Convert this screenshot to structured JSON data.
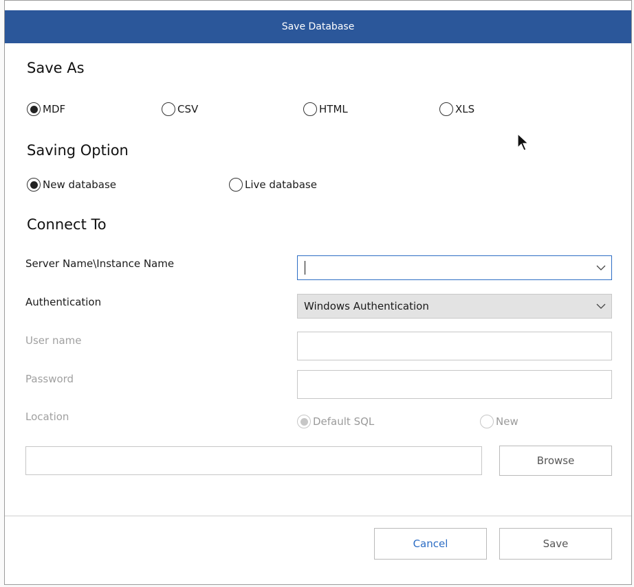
{
  "dialog": {
    "title": "Save Database"
  },
  "save_as": {
    "heading": "Save As",
    "options": [
      {
        "label": "MDF",
        "checked": true
      },
      {
        "label": "CSV",
        "checked": false
      },
      {
        "label": "HTML",
        "checked": false
      },
      {
        "label": "XLS",
        "checked": false
      }
    ]
  },
  "saving_option": {
    "heading": "Saving Option",
    "options": [
      {
        "label": "New database",
        "checked": true
      },
      {
        "label": "Live database",
        "checked": false
      }
    ]
  },
  "connect_to": {
    "heading": "Connect To",
    "server_label": "Server Name\\Instance Name",
    "server_value": "",
    "auth_label": "Authentication",
    "auth_value": "Windows Authentication",
    "username_label": "User name",
    "username_value": "",
    "password_label": "Password",
    "password_value": "",
    "location_label": "Location",
    "location_options": [
      {
        "label": "Default SQL",
        "checked": true
      },
      {
        "label": "New",
        "checked": false
      }
    ],
    "path_value": "",
    "browse_label": "Browse"
  },
  "footer": {
    "cancel_label": "Cancel",
    "save_label": "Save"
  },
  "icons": {
    "dropdown": "chevron-down-icon",
    "pointer": "mouse-pointer-icon"
  }
}
